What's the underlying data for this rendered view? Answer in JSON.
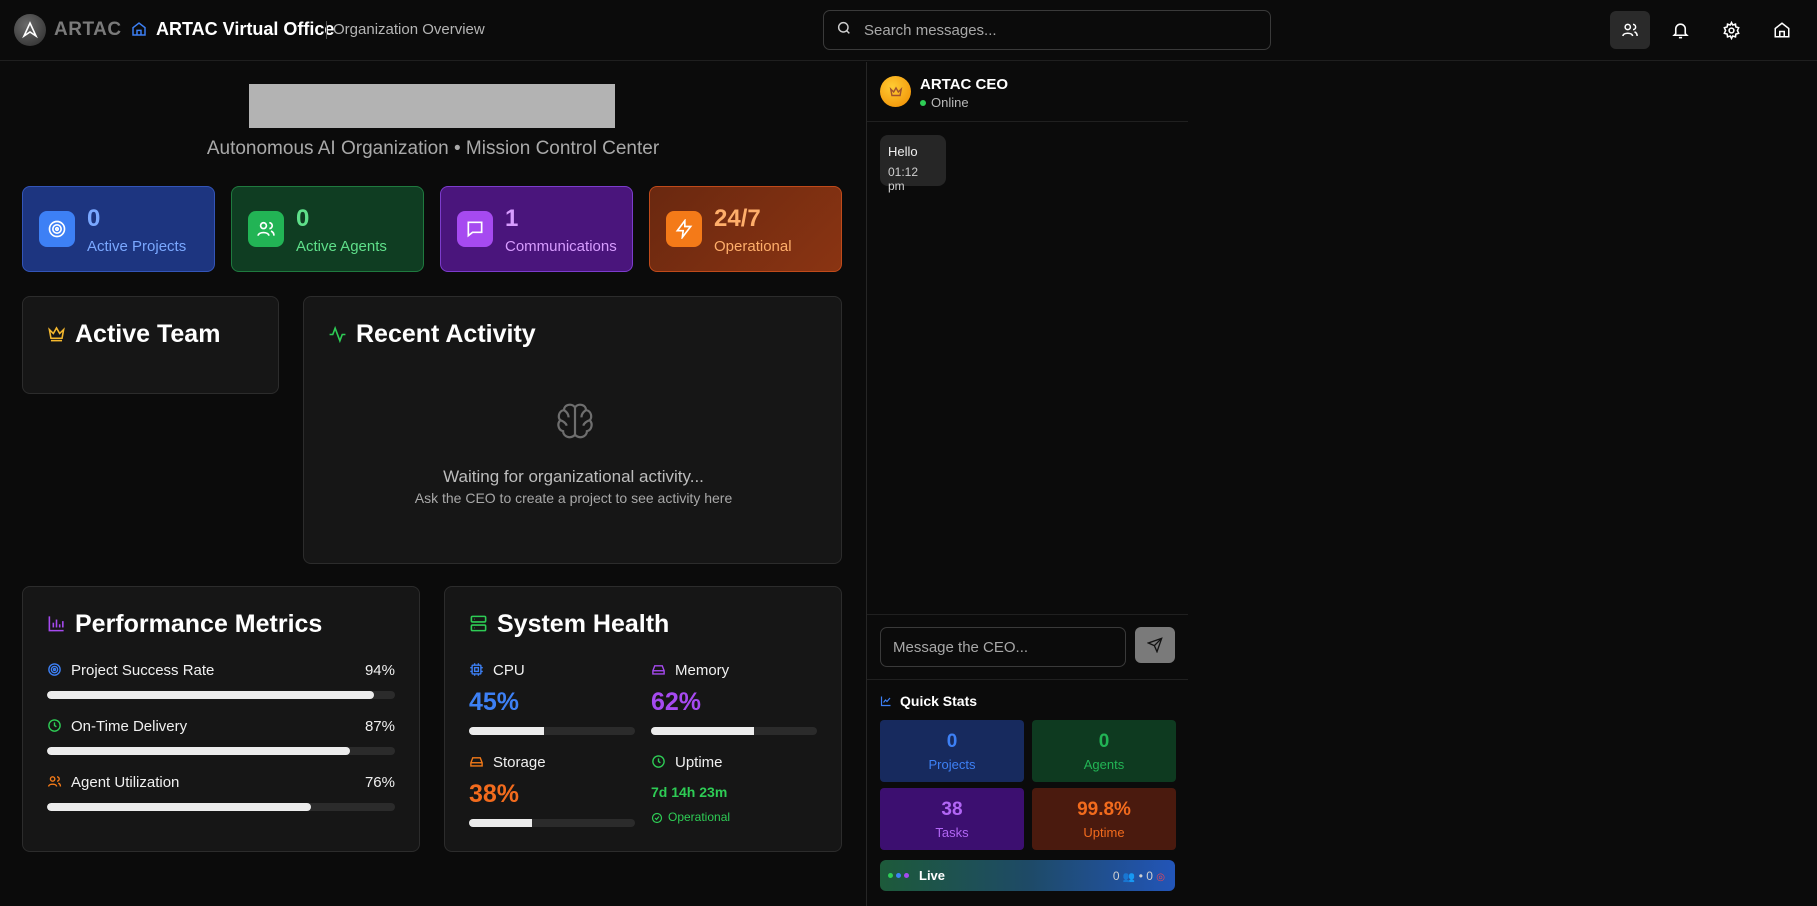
{
  "header": {
    "brand": "ARTAC",
    "office_title": "ARTAC Virtual Office",
    "section": "Organization Overview",
    "search_placeholder": "Search messages..."
  },
  "main": {
    "subtitle": "Autonomous AI Organization • Mission Control Center",
    "stats": [
      {
        "value": "0",
        "label": "Active Projects",
        "icon": "target-icon"
      },
      {
        "value": "0",
        "label": "Active Agents",
        "icon": "users-icon"
      },
      {
        "value": "1",
        "label": "Communications",
        "icon": "message-icon"
      },
      {
        "value": "24/7",
        "label": "Operational",
        "icon": "lightning-icon"
      }
    ],
    "team_title": "Active Team",
    "activity": {
      "title": "Recent Activity",
      "message": "Waiting for organizational activity...",
      "hint": "Ask the CEO to create a project to see activity here"
    },
    "performance": {
      "title": "Performance Metrics",
      "metrics": [
        {
          "label": "Project Success Rate",
          "value": "94%",
          "fraction": 0.94
        },
        {
          "label": "On-Time Delivery",
          "value": "87%",
          "fraction": 0.87
        },
        {
          "label": "Agent Utilization",
          "value": "76%",
          "fraction": 0.76
        }
      ]
    },
    "health": {
      "title": "System Health",
      "cpu": {
        "label": "CPU",
        "value": "45%",
        "fraction": 0.45
      },
      "memory": {
        "label": "Memory",
        "value": "62%",
        "fraction": 0.62
      },
      "storage": {
        "label": "Storage",
        "value": "38%",
        "fraction": 0.38
      },
      "uptime": {
        "label": "Uptime",
        "value": "7d 14h 23m",
        "status": "Operational"
      }
    }
  },
  "chat": {
    "name": "ARTAC CEO",
    "status": "Online",
    "messages": [
      {
        "text": "Hello",
        "time": "01:12 pm"
      }
    ],
    "input_placeholder": "Message the CEO...",
    "quick_stats_title": "Quick Stats",
    "quick_stats": [
      {
        "value": "0",
        "label": "Projects"
      },
      {
        "value": "0",
        "label": "Agents"
      },
      {
        "value": "38",
        "label": "Tasks"
      },
      {
        "value": "99.8%",
        "label": "Uptime"
      }
    ],
    "live_label": "Live",
    "live_counts": [
      "0",
      "0"
    ]
  },
  "colors": {
    "blue": "#3d80f5",
    "green": "#22b455",
    "purple": "#a64af0",
    "orange": "#f47a18"
  }
}
